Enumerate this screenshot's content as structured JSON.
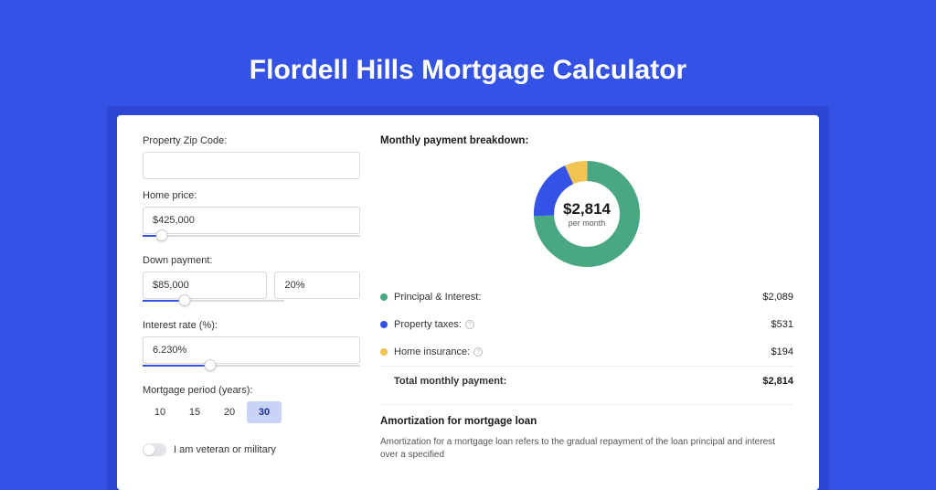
{
  "title": "Flordell Hills Mortgage Calculator",
  "form": {
    "zip_label": "Property Zip Code:",
    "zip_value": "",
    "price_label": "Home price:",
    "price_value": "$425,000",
    "price_slider_pct": 9,
    "down_label": "Down payment:",
    "down_value": "$85,000",
    "down_pct_value": "20%",
    "down_slider_pct": 20,
    "rate_label": "Interest rate (%):",
    "rate_value": "6.230%",
    "rate_slider_pct": 31,
    "period_label": "Mortgage period (years):",
    "periods": [
      "10",
      "15",
      "20",
      "30"
    ],
    "period_active": "30",
    "veteran_label": "I am veteran or military"
  },
  "breakdown": {
    "title": "Monthly payment breakdown:",
    "center_amount": "$2,814",
    "center_sub": "per month",
    "items": [
      {
        "label": "Principal & Interest:",
        "value": "$2,089",
        "color": "#49a882",
        "info": false
      },
      {
        "label": "Property taxes:",
        "value": "$531",
        "color": "#3452e5",
        "info": true
      },
      {
        "label": "Home insurance:",
        "value": "$194",
        "color": "#f1c453",
        "info": true
      }
    ],
    "total_label": "Total monthly payment:",
    "total_value": "$2,814"
  },
  "amort": {
    "title": "Amortization for mortgage loan",
    "text": "Amortization for a mortgage loan refers to the gradual repayment of the loan principal and interest over a specified"
  },
  "chart_data": {
    "type": "pie",
    "title": "Monthly payment breakdown",
    "series": [
      {
        "name": "Principal & Interest",
        "value": 2089,
        "color": "#49a882"
      },
      {
        "name": "Property taxes",
        "value": 531,
        "color": "#3452e5"
      },
      {
        "name": "Home insurance",
        "value": 194,
        "color": "#f1c453"
      }
    ],
    "total": 2814,
    "center_label": "$2,814 per month"
  }
}
